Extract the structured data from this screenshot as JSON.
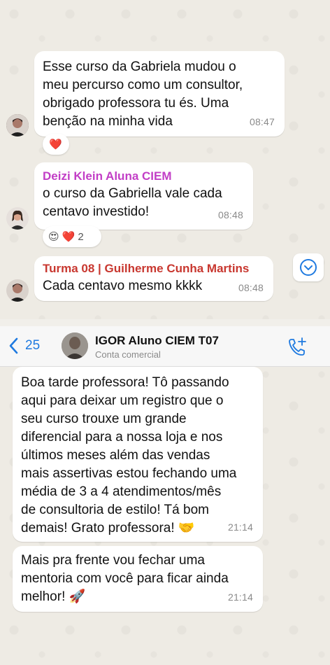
{
  "top_chat": {
    "messages": [
      {
        "sender": "",
        "text": "Esse curso da Gabriela mudou o\nmeu percurso como um consultor,\nobrigado professora tu és. Uma\nbenção na minha vida",
        "time": "08:47",
        "reactions": [
          "❤️"
        ]
      },
      {
        "sender": "Deizi Klein Aluna CIEM",
        "sender_color": "#c23ec6",
        "text": "o curso da Gabriella vale cada\ncentavo investido!",
        "time": "08:48",
        "reactions": [
          "😍",
          "❤️"
        ],
        "reaction_count": "2"
      },
      {
        "sender": "Turma 08 | Guilherme Cunha Martins",
        "sender_color": "#c8372f",
        "text": "Cada centavo mesmo kkkk",
        "time": "08:48"
      }
    ],
    "scroll_down_icon": "chevron-down-circle-icon"
  },
  "header": {
    "back_count": "25",
    "contact_name": "IGOR Aluno CIEM T07",
    "contact_subtitle": "Conta comercial",
    "call_icon": "phone-plus-icon",
    "accent": "#1f7ae0"
  },
  "bottom_chat": {
    "messages": [
      {
        "text": "Boa tarde professora! Tô passando\naqui para deixar um registro que o\nseu curso trouxe um grande\ndiferencial para a nossa loja e nos\núltimos meses além das vendas\nmais assertivas estou fechando uma\nmédia de 3 a 4 atendimentos/mês\nde consultoria de estilo! Tá bom\ndemais! Grato professora! 🤝",
        "time": "21:14"
      },
      {
        "text": "Mais pra frente vou fechar uma\nmentoria com você para ficar ainda\nmelhor! 🚀",
        "time": "21:14"
      }
    ]
  }
}
